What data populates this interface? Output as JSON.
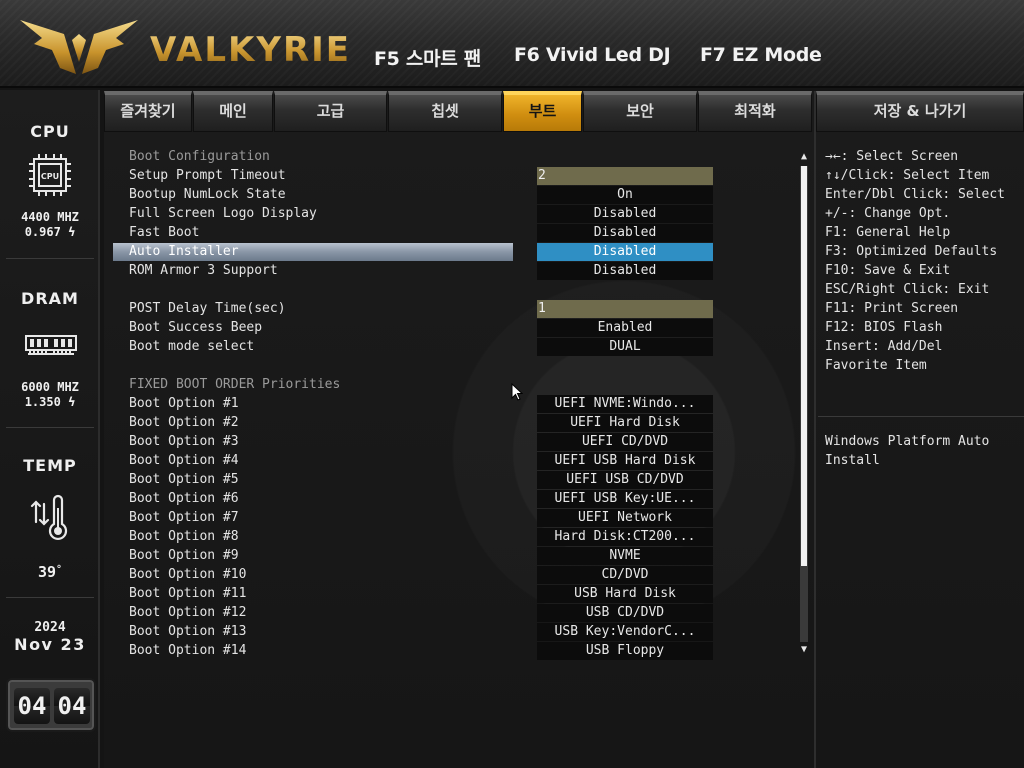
{
  "header": {
    "brand": "VALKYRIE",
    "hotkeys": [
      "F5 스마트 팬",
      "F6 Vivid Led DJ",
      "F7 EZ Mode"
    ]
  },
  "sidebar": {
    "cpu": {
      "title": "CPU",
      "chip_label": "CPU",
      "freq": "4400 MHZ",
      "volt": "0.967",
      "volt_icon": "lightning-icon"
    },
    "dram": {
      "title": "DRAM",
      "freq": "6000 MHZ",
      "volt": "1.350",
      "volt_icon": "lightning-icon"
    },
    "temp": {
      "title": "TEMP",
      "value": "39",
      "unit": "°",
      "icon": "thermometer-icon"
    },
    "date": {
      "year": "2024",
      "month_day": "Nov 23"
    },
    "clock": {
      "hour": "04",
      "minute": "04"
    }
  },
  "tabs": [
    "즐겨찾기",
    "메인",
    "고급",
    "칩셋",
    "부트",
    "보안",
    "최적화",
    "저장 & 나가기"
  ],
  "active_tab": "부트",
  "settings": {
    "section1": "Boot Configuration",
    "rows1": [
      {
        "label": "Setup Prompt Timeout",
        "value": "2"
      },
      {
        "label": "Bootup NumLock State",
        "value": "On"
      },
      {
        "label": "Full Screen Logo Display",
        "value": "Disabled"
      },
      {
        "label": "Fast Boot",
        "value": "Disabled"
      },
      {
        "label": "Auto Installer",
        "value": "Disabled"
      },
      {
        "label": "ROM Armor 3 Support",
        "value": "Disabled"
      }
    ],
    "rows2": [
      {
        "label": "POST Delay Time(sec)",
        "value": "1"
      },
      {
        "label": "Boot Success Beep",
        "value": "Enabled"
      },
      {
        "label": "Boot mode select",
        "value": "DUAL"
      }
    ],
    "section2": "FIXED BOOT ORDER Priorities",
    "boot_options": [
      {
        "label": "Boot Option #1",
        "value": "UEFI NVME:Windo..."
      },
      {
        "label": "Boot Option #2",
        "value": "UEFI Hard Disk"
      },
      {
        "label": "Boot Option #3",
        "value": "UEFI CD/DVD"
      },
      {
        "label": "Boot Option #4",
        "value": "UEFI USB Hard Disk"
      },
      {
        "label": "Boot Option #5",
        "value": "UEFI USB CD/DVD"
      },
      {
        "label": "Boot Option #6",
        "value": "UEFI USB Key:UE..."
      },
      {
        "label": "Boot Option #7",
        "value": "UEFI Network"
      },
      {
        "label": "Boot Option #8",
        "value": "Hard Disk:CT200..."
      },
      {
        "label": "Boot Option #9",
        "value": "NVME"
      },
      {
        "label": "Boot Option #10",
        "value": "CD/DVD"
      },
      {
        "label": "Boot Option #11",
        "value": "USB Hard Disk"
      },
      {
        "label": "Boot Option #12",
        "value": "USB CD/DVD"
      },
      {
        "label": "Boot Option #13",
        "value": "USB Key:VendorC..."
      },
      {
        "label": "Boot Option #14",
        "value": "USB Floppy"
      }
    ]
  },
  "help": {
    "keys": [
      "→←: Select Screen",
      "↑↓/Click: Select Item",
      "Enter/Dbl Click: Select",
      "+/-: Change Opt.",
      "F1: General Help",
      "F3: Optimized Defaults",
      "F10: Save & Exit",
      "ESC/Right Click: Exit",
      "F11: Print Screen",
      "F12: BIOS Flash",
      "Insert: Add/Del",
      "Favorite Item"
    ],
    "description": [
      "Windows Platform Auto",
      "Install"
    ]
  },
  "scroll": {
    "up_icon": "scroll-up-arrow-icon",
    "down_icon": "scroll-down-arrow-icon"
  },
  "colors": {
    "accent": "#E0A01A",
    "selected_value": "#2F8FC4",
    "numeric_field": "#6F6B4C"
  }
}
